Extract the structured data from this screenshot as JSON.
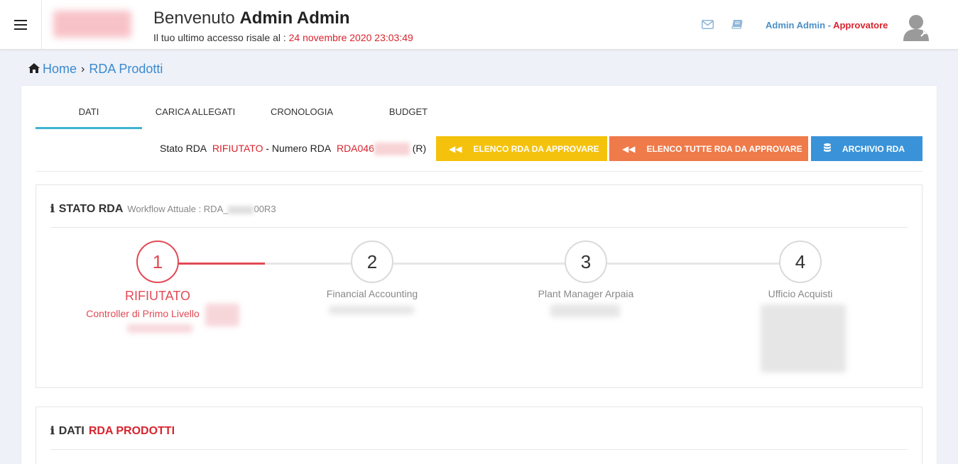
{
  "header": {
    "welcome_prefix": "Benvenuto",
    "welcome_name": "Admin Admin",
    "last_access_label": "Il tuo ultimo accesso risale al :",
    "last_access_date": "24 novembre 2020 23:03:49",
    "user_name": "Admin Admin",
    "user_sep": " - ",
    "user_role": "Approvatore",
    "icons": [
      "menu-icon",
      "envelope-icon",
      "book-icon",
      "user-avatar-icon"
    ]
  },
  "breadcrumb": {
    "home": "Home",
    "current": "RDA Prodotti"
  },
  "tabs": [
    {
      "label": "DATI",
      "active": true
    },
    {
      "label": "CARICA ALLEGATI",
      "active": false
    },
    {
      "label": "CRONOLOGIA",
      "active": false
    },
    {
      "label": "BUDGET",
      "active": false
    }
  ],
  "status_bar": {
    "stato_label": "Stato RDA",
    "stato_value": "RIFIUTATO",
    "numero_label": "- Numero RDA",
    "numero_value_prefix": "RDA046",
    "numero_suffix": "(R)"
  },
  "buttons": {
    "elenco_da_approvare": "ELENCO RDA DA APPROVARE",
    "elenco_tutte": "ELENCO TUTTE RDA DA APPROVARE",
    "archivio": "ARCHIVIO RDA"
  },
  "stato_panel": {
    "title": "STATO RDA",
    "workflow_label": "Workflow Attuale : RDA_",
    "workflow_suffix": "00R3",
    "steps": [
      {
        "number": "1",
        "label": "RIFIUTATO",
        "sub": "Controller di Primo Livello",
        "state": "rejected"
      },
      {
        "number": "2",
        "label": "Financial Accounting",
        "state": "pending"
      },
      {
        "number": "3",
        "label": "Plant Manager Arpaia",
        "state": "pending"
      },
      {
        "number": "4",
        "label": "Ufficio Acquisti",
        "state": "pending"
      }
    ]
  },
  "dati_panel": {
    "title_prefix": "DATI",
    "title_highlight": "RDA PRODOTTI"
  },
  "colors": {
    "accent_red": "#d9232d",
    "tab_active": "#3fb3cf",
    "btn_yellow": "#f4c20d",
    "btn_orange": "#ef7a4a",
    "btn_blue": "#3a93d8",
    "link_blue": "#3a8ad0"
  }
}
